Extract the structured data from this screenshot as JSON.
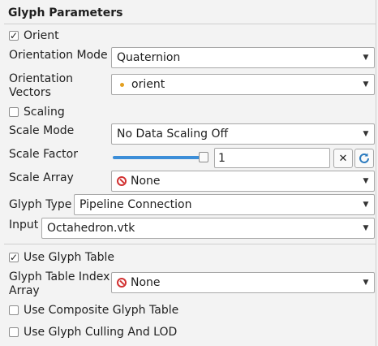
{
  "section_title": "Glyph Parameters",
  "orient": {
    "label": "Orient",
    "checked": true,
    "check": "✓"
  },
  "orientation_mode": {
    "label": "Orientation Mode",
    "value": "Quaternion"
  },
  "orientation_vectors": {
    "label_line1": "Orientation",
    "label_line2": "Vectors",
    "value": "orient",
    "icon": "point-data-icon"
  },
  "scaling": {
    "label": "Scaling",
    "checked": false
  },
  "scale_mode": {
    "label": "Scale Mode",
    "value": "No Data Scaling Off"
  },
  "scale_factor": {
    "label": "Scale Factor",
    "value": "1",
    "slider_fraction": 1.0
  },
  "scale_array": {
    "label": "Scale Array",
    "value": "None",
    "icon": "none-icon"
  },
  "glyph_type": {
    "label": "Glyph Type",
    "value": "Pipeline Connection"
  },
  "input": {
    "label": "Input",
    "value": "Octahedron.vtk"
  },
  "use_glyph_table": {
    "label": "Use Glyph Table",
    "checked": true,
    "check": "✓"
  },
  "glyph_table_index": {
    "label_line1": "Glyph Table Index",
    "label_line2": "Array",
    "value": "None",
    "icon": "none-icon"
  },
  "use_composite": {
    "label": "Use Composite Glyph Table",
    "checked": false
  },
  "use_culling": {
    "label": "Use Glyph Culling And LOD",
    "checked": false
  },
  "buttons": {
    "clear_icon": "clear-x-icon",
    "reset_icon": "refresh-icon"
  },
  "colors": {
    "accent": "#3c8ed8",
    "none_red": "#d23232",
    "point_orange": "#e3a020"
  }
}
